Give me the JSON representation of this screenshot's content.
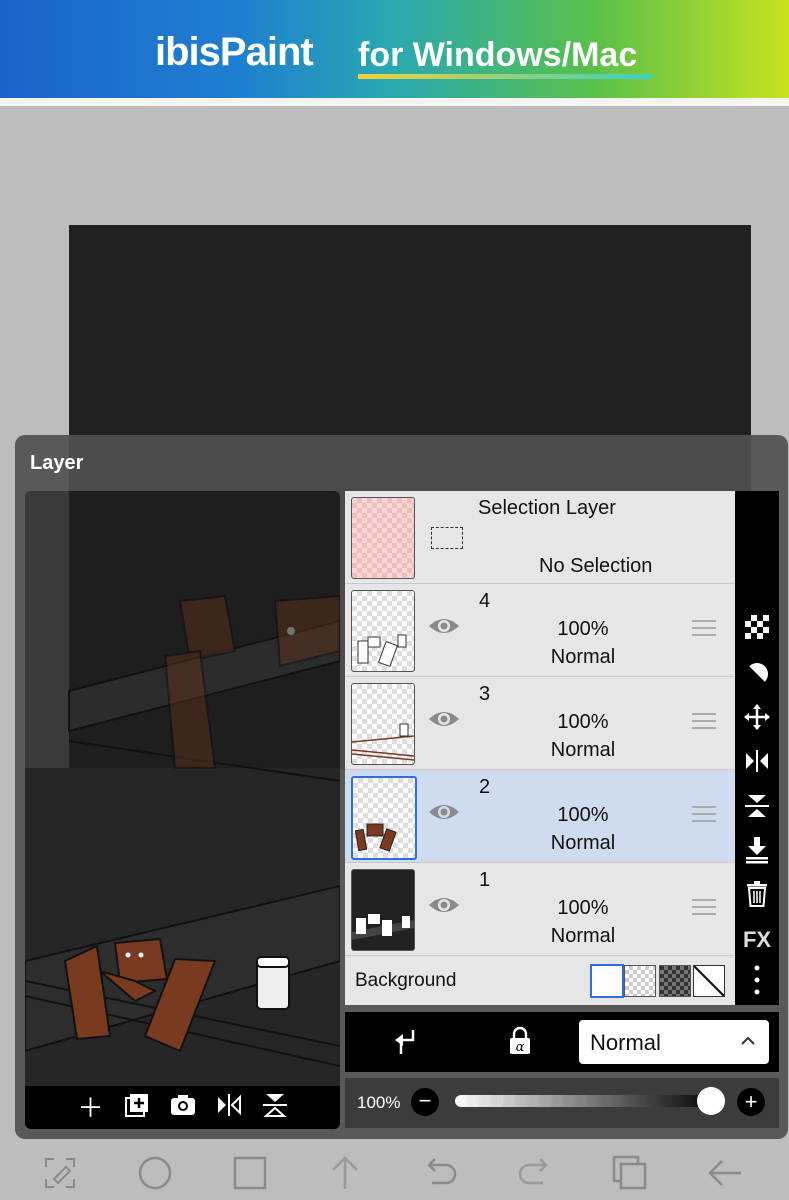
{
  "banner": {
    "logo_text": "ibisPaint",
    "tagline": "for Windows/Mac"
  },
  "panel": {
    "title": "Layer"
  },
  "selection_layer": {
    "name": "Selection Layer",
    "status": "No Selection"
  },
  "layers": [
    {
      "name": "4",
      "opacity": "100%",
      "mode": "Normal",
      "selected": false
    },
    {
      "name": "3",
      "opacity": "100%",
      "mode": "Normal",
      "selected": false
    },
    {
      "name": "2",
      "opacity": "100%",
      "mode": "Normal",
      "selected": true
    },
    {
      "name": "1",
      "opacity": "100%",
      "mode": "Normal",
      "selected": false
    }
  ],
  "background": {
    "label": "Background"
  },
  "right_tools": {
    "fx_label": "FX"
  },
  "blend": {
    "mode": "Normal"
  },
  "opacity": {
    "label": "100%",
    "value": 1.0
  },
  "colors": {
    "selected_row": "#cfdcef",
    "accent": "#2f6fd6"
  }
}
